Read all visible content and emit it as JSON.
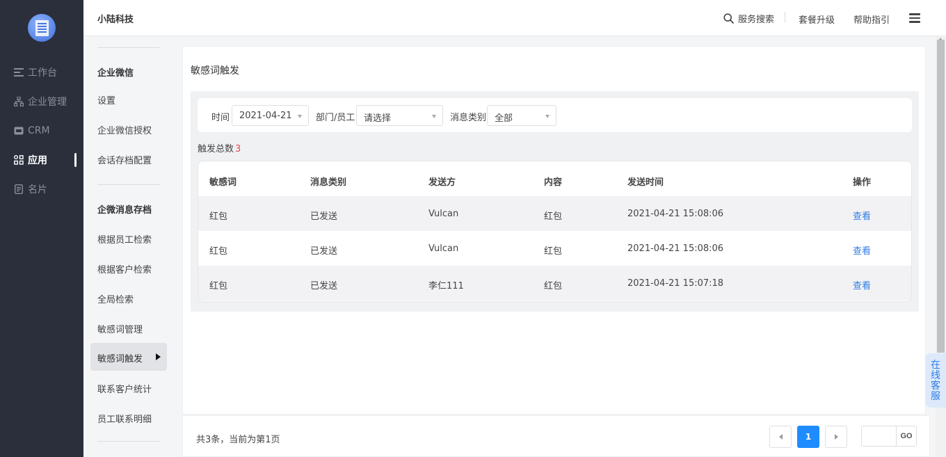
{
  "nav": {
    "items": [
      {
        "label": "工作台",
        "icon": "workbench-icon"
      },
      {
        "label": "企业管理",
        "icon": "org-chart-icon"
      },
      {
        "label": "CRM",
        "icon": "crm-icon"
      },
      {
        "label": "应用",
        "icon": "apps-icon",
        "active": true
      },
      {
        "label": "名片",
        "icon": "card-icon"
      }
    ]
  },
  "header": {
    "company": "小陆科技",
    "search_label": "服务搜索",
    "upgrade_label": "套餐升级",
    "help_label": "帮助指引"
  },
  "subnav": {
    "group1_title": "企业微信",
    "group1_items": [
      "设置",
      "企业微信授权",
      "会话存档配置"
    ],
    "group2_title": "企微消息存档",
    "group2_items": [
      "根据员工检索",
      "根据客户检索",
      "全局检索",
      "敏感词管理"
    ],
    "active_item": "敏感词触发",
    "group2_items_after": [
      "联系客户统计",
      "员工联系明细"
    ]
  },
  "page": {
    "title": "敏感词触发"
  },
  "filters": {
    "time_label": "时间",
    "time_value": "2021-04-21",
    "dept_label": "部门/员工",
    "dept_placeholder": "请选择",
    "type_label": "消息类别",
    "type_value": "全部"
  },
  "summary": {
    "label": "触发总数",
    "count": "3"
  },
  "table": {
    "columns": [
      "敏感词",
      "消息类别",
      "发送方",
      "内容",
      "发送时间",
      "操作"
    ],
    "rows": [
      {
        "word": "红包",
        "type": "已发送",
        "sender": "Vulcan",
        "content": "红包",
        "time": "2021-04-21 15:08:06",
        "action": "查看"
      },
      {
        "word": "红包",
        "type": "已发送",
        "sender": "Vulcan",
        "content": "红包",
        "time": "2021-04-21 15:08:06",
        "action": "查看"
      },
      {
        "word": "红包",
        "type": "已发送",
        "sender": "李仁111",
        "content": "红包",
        "time": "2021-04-21 15:07:18",
        "action": "查看"
      }
    ]
  },
  "pagination": {
    "info": "共3条，当前为第1页",
    "current_page": "1",
    "go_label": "GO",
    "jump_value": ""
  },
  "support": {
    "label": "在线客服"
  },
  "colors": {
    "nav_bg": "#2a2f3b",
    "accent": "#1e8cff",
    "link": "#2f7ee8",
    "count": "#e5484d"
  }
}
